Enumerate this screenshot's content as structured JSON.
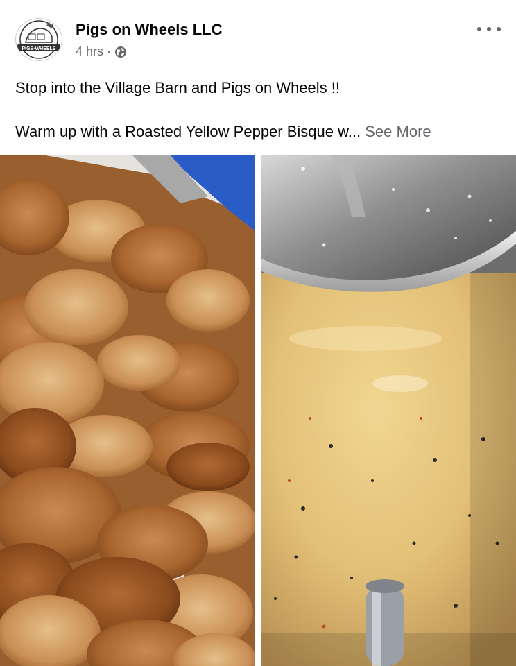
{
  "post": {
    "page_name": "Pigs on Wheels LLC",
    "timestamp": "4 hrs",
    "separator": "·",
    "privacy_icon": "globe-icon",
    "more_icon": "more-options-icon",
    "avatar_logo_text": "PIGS ON WHEELS",
    "text_line_1": "Stop into the Village Barn and Pigs on Wheels !!",
    "text_line_2": "Warm up with a Roasted Yellow Pepper Bisque w...",
    "see_more_label": "See More"
  },
  "photos": [
    {
      "subject": "potato-chips"
    },
    {
      "subject": "pepper-bisque"
    }
  ],
  "colors": {
    "secondary_text": "#65676b",
    "primary_text": "#050505"
  }
}
